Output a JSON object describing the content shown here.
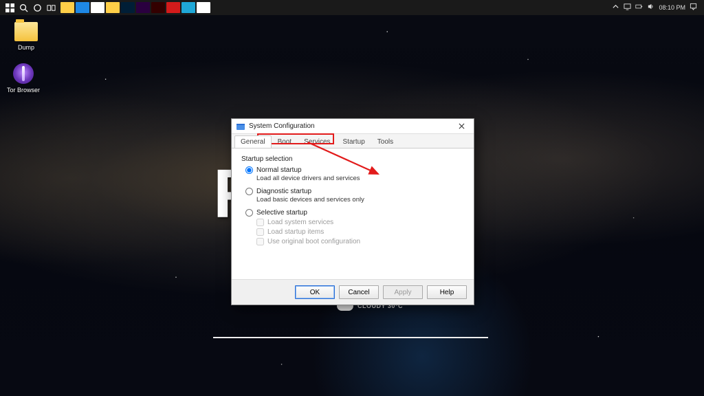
{
  "taskbar": {
    "apps": [
      {
        "name": "file-explorer",
        "color": "#ffcf48"
      },
      {
        "name": "edge",
        "color": "#1e88e5"
      },
      {
        "name": "chrome",
        "color": "#ffffff"
      },
      {
        "name": "explorer-2",
        "color": "#ffcf48"
      },
      {
        "name": "photoshop",
        "color": "#001e36"
      },
      {
        "name": "premiere",
        "color": "#2a003f"
      },
      {
        "name": "adobe-uc",
        "color": "#330000"
      },
      {
        "name": "opera",
        "color": "#d31b1b"
      },
      {
        "name": "app-5",
        "color": "#1fa8d8"
      },
      {
        "name": "app-doc",
        "color": "#ffffff"
      }
    ],
    "clock": "08:10 PM"
  },
  "icons": {
    "dump": "Dump",
    "tor": "Tor Browser"
  },
  "weather": "CLOUDY 30°C",
  "dialog": {
    "title": "System Configuration",
    "tabs": [
      "General",
      "Boot",
      "Services",
      "Startup",
      "Tools"
    ],
    "active_tab": 0,
    "group": "Startup selection",
    "opt_normal": "Normal startup",
    "opt_normal_sub": "Load all device drivers and services",
    "opt_diag": "Diagnostic startup",
    "opt_diag_sub": "Load basic devices and services only",
    "opt_sel": "Selective startup",
    "chk_services": "Load system services",
    "chk_startup": "Load startup items",
    "chk_original": "Use original boot configuration",
    "btn_ok": "OK",
    "btn_cancel": "Cancel",
    "btn_apply": "Apply",
    "btn_help": "Help"
  },
  "annotation": {
    "highlight_tabs": [
      "Boot",
      "Services",
      "Startup"
    ]
  }
}
